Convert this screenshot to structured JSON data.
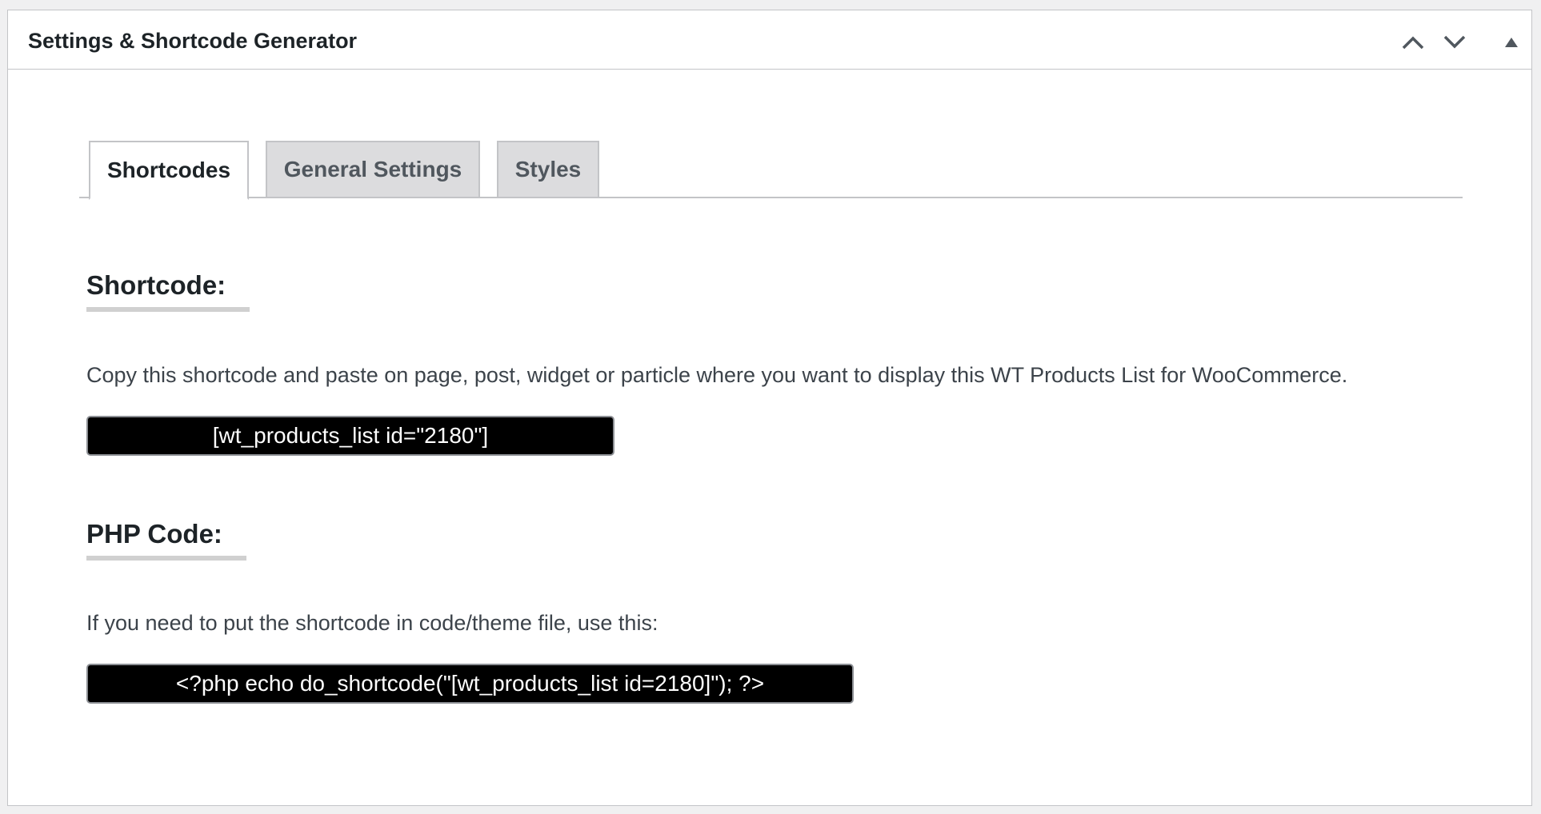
{
  "panel": {
    "title": "Settings & Shortcode Generator",
    "controls": {
      "move_up_icon": "chevron-up-icon",
      "move_down_icon": "chevron-down-icon",
      "toggle_icon": "triangle-up-icon"
    }
  },
  "tabs": [
    {
      "label": "Shortcodes",
      "active": true
    },
    {
      "label": "General Settings",
      "active": false
    },
    {
      "label": "Styles",
      "active": false
    }
  ],
  "shortcode_section": {
    "heading": "Shortcode:",
    "description": "Copy this shortcode and paste on page, post, widget or particle where you want to display this WT Products List for WooCommerce.",
    "value": "[wt_products_list id=\"2180\"]"
  },
  "php_section": {
    "heading": "PHP Code:",
    "description": "If you need to put the shortcode in code/theme file, use this:",
    "value": "<?php echo do_shortcode(\"[wt_products_list id=2180]\"); ?>"
  },
  "colors": {
    "page_background": "#f0f0f1",
    "panel_background": "#ffffff",
    "code_background": "#000000",
    "code_text": "#ffffff",
    "inactive_tab": "#dcdcde"
  }
}
